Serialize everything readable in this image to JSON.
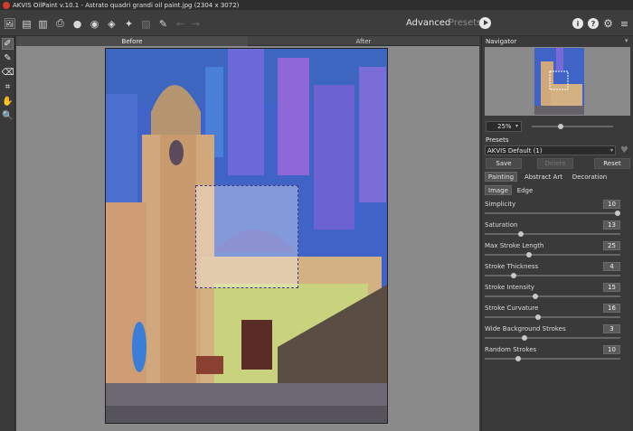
{
  "window": {
    "title": "AKVIS OilPaint v.10.1 - Astrato quadri grandi oil paint.jpg (2304 x 3072)"
  },
  "toolbar": {
    "mode_advanced": "Advanced",
    "mode_presets": "Presets"
  },
  "tabs": {
    "before": "Before",
    "after": "After"
  },
  "navigator": {
    "title": "Navigator",
    "zoom": "25%",
    "zoom_level": 0.35
  },
  "presets": {
    "title": "Presets",
    "selected": "AKVIS Default (1)",
    "save_label": "Save",
    "delete_label": "Delete",
    "reset_label": "Reset"
  },
  "main_tabs": [
    "Painting",
    "Abstract Art",
    "Decoration"
  ],
  "sub_tabs": [
    "Image",
    "Edge"
  ],
  "params": [
    {
      "label": "Simplicity",
      "value": "10",
      "level": 1.0
    },
    {
      "label": "Saturation",
      "value": "13",
      "level": 0.27
    },
    {
      "label": "Max Stroke Length",
      "value": "25",
      "level": 0.33
    },
    {
      "label": "Stroke Thickness",
      "value": "4",
      "level": 0.22
    },
    {
      "label": "Stroke Intensity",
      "value": "15",
      "level": 0.38
    },
    {
      "label": "Stroke Curvature",
      "value": "16",
      "level": 0.4
    },
    {
      "label": "Wide Background Strokes",
      "value": "3",
      "level": 0.3
    },
    {
      "label": "Random Strokes",
      "value": "10",
      "level": 0.25
    }
  ],
  "colors": {
    "panel": "#3a3a3a",
    "canvas_bg": "#8a8a8a",
    "accent_red": "#d23a2e"
  }
}
